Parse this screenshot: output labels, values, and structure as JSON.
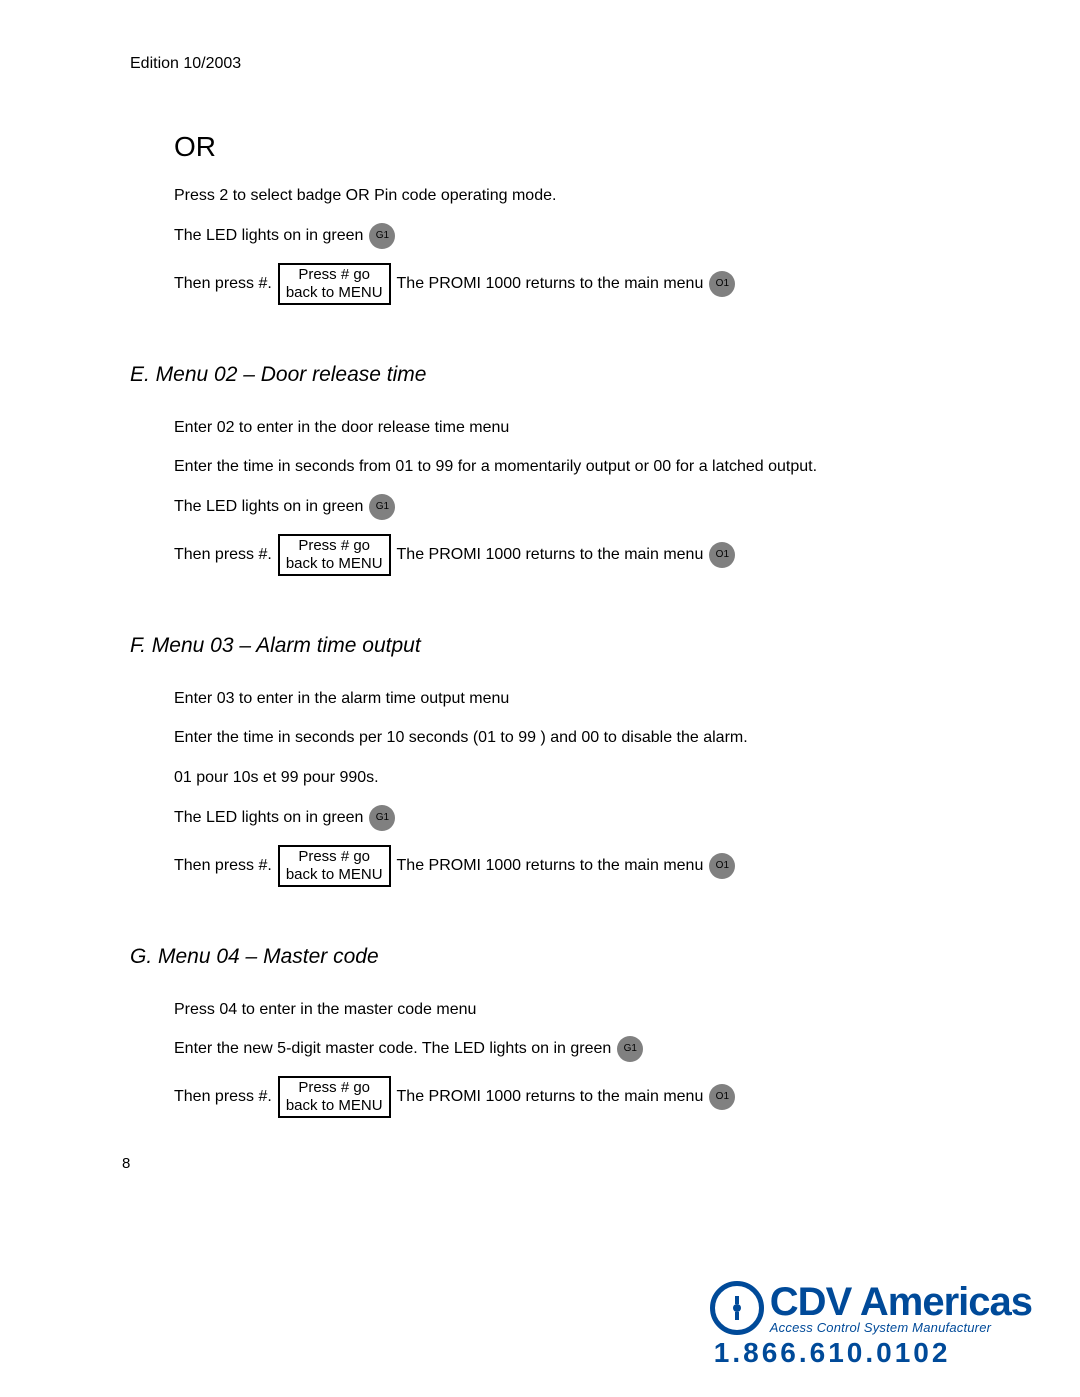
{
  "header": {
    "edition": "Edition 10/2003"
  },
  "or_section": {
    "title": "OR",
    "press2": "Press 2 to select badge OR Pin code operating mode.",
    "led_green": "The LED lights on in green",
    "led_badge_g1": "G1",
    "then_press": "Then press #.",
    "box_line1": "Press # go",
    "box_line2": "back to MENU",
    "return_text": "The PROMI 1000 returns to the main menu",
    "led_badge_o1": "O1"
  },
  "section_e": {
    "title": "E.  Menu 02 – Door release time",
    "enter": "Enter 02 to enter in the door release time menu",
    "enter_time": "Enter the time in seconds from 01 to 99 for a momentarily output or 00 for a latched output.",
    "led_green": "The LED lights on in green",
    "led_badge_g1": "G1",
    "then_press": "Then press #.",
    "box_line1": "Press # go",
    "box_line2": "back to MENU",
    "return_text": "The PROMI 1000 returns to the main menu",
    "led_badge_o1": "O1"
  },
  "section_f": {
    "title": "F.  Menu 03 – Alarm time output",
    "enter": "Enter 03 to enter in the alarm time output menu",
    "enter_time": "Enter the time in seconds per 10 seconds (01 to 99 ) and 00 to disable the alarm.",
    "pour": "01 pour 10s et 99 pour 990s.",
    "led_green": "The LED lights on in green",
    "led_badge_g1": "G1",
    "then_press": "Then press #.",
    "box_line1": "Press # go",
    "box_line2": "back to MENU",
    "return_text": "The PROMI 1000 returns to the main menu",
    "led_badge_o1": "O1"
  },
  "section_g": {
    "title": "G.  Menu 04 – Master code",
    "press": "Press 04 to enter in the master code menu",
    "enter_new": "Enter the new 5-digit master code.  The LED lights on in green",
    "led_badge_g1": "G1",
    "then_press": "Then press #.",
    "box_line1": "Press # go",
    "box_line2": "back to MENU",
    "return_text": "The PROMI 1000 returns to the main menu",
    "led_badge_o1": "O1"
  },
  "footer": {
    "page_number": "8",
    "logo_name": "CDV Americas",
    "logo_sub": "Access Control System Manufacturer",
    "phone": "1.866.610.0102"
  }
}
